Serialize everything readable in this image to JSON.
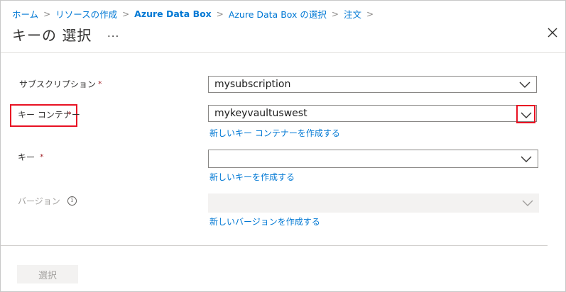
{
  "breadcrumb": {
    "items": [
      "ホーム",
      "リソースの作成",
      "Azure Data Box",
      "Azure Data Box の選択",
      "注文"
    ],
    "separator": ">"
  },
  "header": {
    "title": "キーの 選択",
    "more_label": "...",
    "close_icon": "close-icon"
  },
  "form": {
    "subscription": {
      "label": "サブスクリプション",
      "required": "*",
      "value": "mysubscription"
    },
    "key_container": {
      "label": "キー コンテナー",
      "required": "*",
      "value": "mykeyvaultuswest",
      "create_link": "新しいキー コンテナーを作成する"
    },
    "key": {
      "label": "キー",
      "required": "*",
      "value": "",
      "create_link": "新しいキーを作成する"
    },
    "version": {
      "label": "バージョン",
      "info_icon": "i",
      "value": "",
      "create_link": "新しいバージョンを作成する"
    }
  },
  "footer": {
    "select_button": "選択"
  },
  "colors": {
    "accent": "#0078d4",
    "highlight": "#e81123",
    "required": "#a4262c",
    "disabled_bg": "#f3f2f1"
  }
}
